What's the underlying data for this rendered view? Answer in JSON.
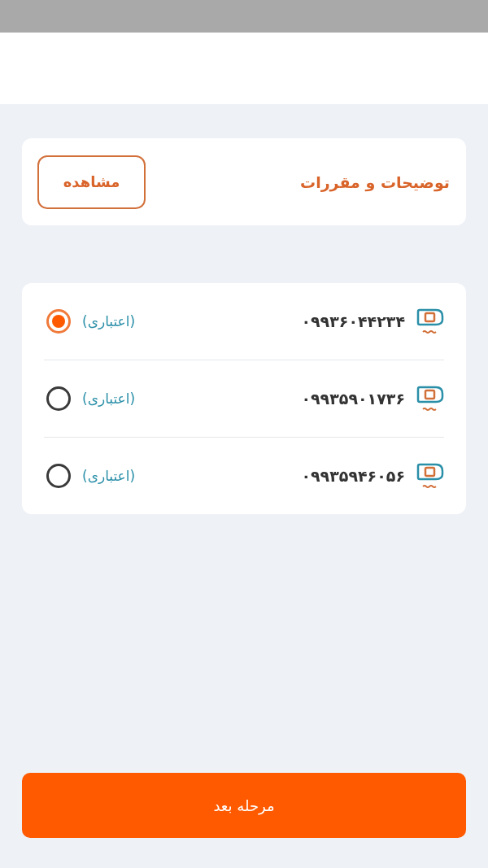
{
  "terms": {
    "title": "توضیحات و مقررات",
    "button": "مشاهده"
  },
  "lines": [
    {
      "number": "۰۹۹۳۶۰۴۴۲۳۴",
      "type": "(اعتباری)",
      "selected": true
    },
    {
      "number": "۰۹۹۳۵۹۰۱۷۳۶",
      "type": "(اعتباری)",
      "selected": false
    },
    {
      "number": "۰۹۹۳۵۹۴۶۰۵۶",
      "type": "(اعتباری)",
      "selected": false
    }
  ],
  "next_button": "مرحله بعد"
}
